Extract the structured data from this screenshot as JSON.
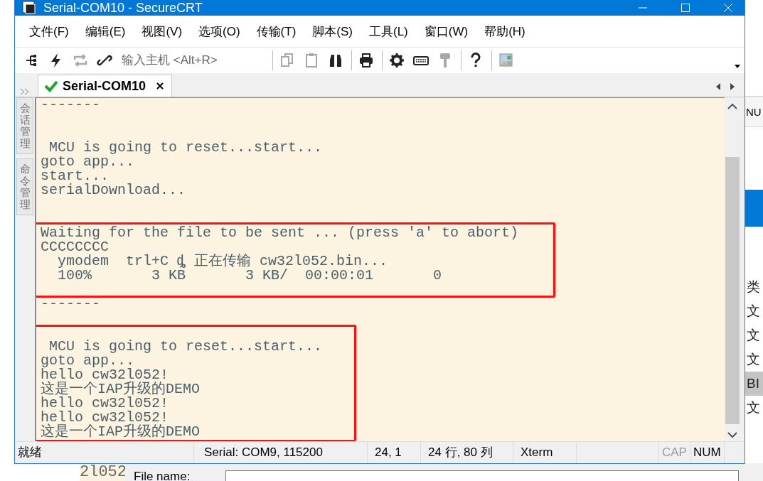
{
  "window": {
    "title": "Serial-COM10 - SecureCRT"
  },
  "menu": [
    "文件(F)",
    "编辑(E)",
    "视图(V)",
    "选项(O)",
    "传输(T)",
    "脚本(S)",
    "工具(L)",
    "窗口(W)",
    "帮助(H)"
  ],
  "toolbar": {
    "left": [
      {
        "kind": "connect",
        "disabled": false
      },
      {
        "kind": "lightning",
        "disabled": false
      },
      {
        "kind": "reconnect",
        "disabled": true
      },
      {
        "kind": "link",
        "disabled": false
      }
    ],
    "host": {
      "placeholder": "输入主机 <Alt+R>"
    },
    "right": [
      {
        "kind": "sep"
      },
      {
        "kind": "copy",
        "disabled": true
      },
      {
        "kind": "paste",
        "disabled": true
      },
      {
        "kind": "find",
        "disabled": false
      },
      {
        "kind": "sep"
      },
      {
        "kind": "print",
        "disabled": false
      },
      {
        "kind": "sep"
      },
      {
        "kind": "settings",
        "disabled": false
      },
      {
        "kind": "keyboard",
        "disabled": false
      },
      {
        "kind": "key",
        "disabled": true
      },
      {
        "kind": "sep"
      },
      {
        "kind": "help",
        "disabled": false
      },
      {
        "kind": "sep"
      },
      {
        "kind": "lockimage",
        "disabled": false
      }
    ]
  },
  "tabs": [
    {
      "label": "Serial-COM10",
      "selected": true,
      "connected": true
    }
  ],
  "sidebar_tabs": [
    "会话管理",
    "命令管理"
  ],
  "terminal": {
    "lines": [
      {
        "kind": "text",
        "text": "-------"
      },
      {
        "kind": "blank"
      },
      {
        "kind": "blank"
      },
      {
        "kind": "text",
        "text": " MCU is going to reset...start..."
      },
      {
        "kind": "text",
        "text": "goto app..."
      },
      {
        "kind": "text",
        "text": "start..."
      },
      {
        "kind": "text",
        "text": "serialDownload..."
      },
      {
        "kind": "blank"
      },
      {
        "kind": "blank"
      },
      {
        "kind": "text",
        "text": "Waiting for the file to be sent ... (press 'a' to abort)"
      },
      {
        "kind": "text",
        "text": "CCCCCCCC"
      },
      {
        "kind": "text",
        "text": "  ymodem  trl+C ȡ 正在传输 cw32l052.bin..."
      },
      {
        "kind": "text",
        "text": "  100%       3 KB       3 KB/  00:00:01       0"
      },
      {
        "kind": "blank"
      },
      {
        "kind": "text",
        "text": "-------"
      },
      {
        "kind": "blank"
      },
      {
        "kind": "blank"
      },
      {
        "kind": "text",
        "text": " MCU is going to reset...start..."
      },
      {
        "kind": "text",
        "text": "goto app..."
      },
      {
        "kind": "text",
        "text": "hello cw32l052!"
      },
      {
        "kind": "text",
        "text": "这是一个IAP升级的DEMO"
      },
      {
        "kind": "text",
        "text": "hello cw32l052!"
      },
      {
        "kind": "text",
        "text": "hello cw32l052!"
      },
      {
        "kind": "text",
        "text": "这是一个IAP升级的DEMO"
      }
    ]
  },
  "status_bar": {
    "message": "就绪",
    "sections": [
      "Serial: COM9, 115200",
      "24,  1",
      "24 行, 80 列",
      "Xterm"
    ],
    "indicators": [
      {
        "label": "CAP",
        "on": false
      },
      {
        "label": "NUM",
        "on": true
      }
    ]
  },
  "background": {
    "status_text": "NU",
    "right_texts": [
      {
        "text": "类",
        "selected": false
      },
      {
        "text": "文",
        "selected": false
      },
      {
        "text": "文",
        "selected": false
      },
      {
        "text": "文",
        "selected": false
      },
      {
        "text": "BI",
        "selected": true
      },
      {
        "text": "文",
        "selected": false
      }
    ],
    "terminal_fragment": "2l052",
    "file_label": "File name:"
  }
}
